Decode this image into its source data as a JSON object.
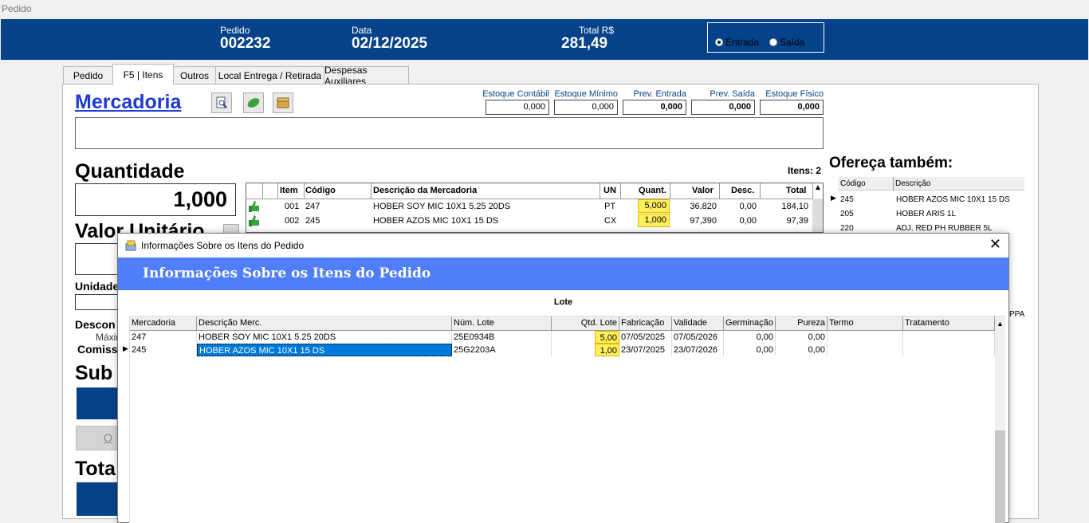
{
  "window": {
    "title": "Pedido"
  },
  "header": {
    "pedido_label": "Pedido",
    "pedido_value": "002232",
    "data_label": "Data",
    "data_value": "02/12/2025",
    "total_label": "Total R$",
    "total_value": "281,49",
    "radio_entrada": "Entrada",
    "radio_saida": "Saída",
    "selected_radio": "Entrada"
  },
  "tabs": [
    {
      "label": "Pedido"
    },
    {
      "label": "F5 | Itens"
    },
    {
      "label": "Outros"
    },
    {
      "label": "Local Entrega  / Retirada"
    },
    {
      "label": "Despesas Auxiliares"
    }
  ],
  "active_tab": "F5 | Itens",
  "form": {
    "mercadoria_title": "Mercadoria",
    "quantidade_label": "Quantidade",
    "quantidade_value": "1,000",
    "valor_unitario_label": "Valor Unitário",
    "unidade_label": "Unidade",
    "desconto_label": "Descon",
    "maximo_label": "Máxim",
    "comissao_label": "Comiss",
    "subtotal_label": "Sub",
    "total_label": "Tota",
    "ok_button_label": "O"
  },
  "stock": [
    {
      "label": "Estoque Contábil",
      "value": "0,000"
    },
    {
      "label": "Estoque Mínimo",
      "value": "0,000"
    },
    {
      "label": "Prev. Entrada",
      "value": "0,000"
    },
    {
      "label": "Prev. Saída",
      "value": "0,000"
    },
    {
      "label": "Estoque Físico",
      "value": "0,000"
    }
  ],
  "items_grid": {
    "count_label": "Itens: 2",
    "columns": [
      "Item",
      "Código",
      "Descrição da Mercadoria",
      "UN",
      "Quant.",
      "Valor",
      "Desc.",
      "Total"
    ],
    "rows": [
      {
        "item": "001",
        "codigo": "247",
        "descricao": "HOBER SOY MIC 10X1 5.25 20DS",
        "un": "PT",
        "quant": "5,000",
        "valor": "36,820",
        "desc": "0,00",
        "total": "184,10"
      },
      {
        "item": "002",
        "codigo": "245",
        "descricao": "HOBER AZOS MIC 10X1 15 DS",
        "un": "CX",
        "quant": "1,000",
        "valor": "97,390",
        "desc": "0,00",
        "total": "97,39"
      }
    ]
  },
  "offer": {
    "title": "Ofereça também:",
    "columns": [
      "Código",
      "Descrição"
    ],
    "rows": [
      {
        "codigo": "245",
        "descricao": "HOBER AZOS MIC 10X1 15 DS"
      },
      {
        "codigo": "205",
        "descricao": "HOBER ARIS 1L"
      },
      {
        "codigo": "220",
        "descricao": "ADJ. RED PH  RUBBER 5L"
      }
    ],
    "partial_text": "PPA"
  },
  "modal": {
    "title": "Informações Sobre os Itens do Pedido",
    "banner": "Informações Sobre os Itens do Pedido",
    "section_label": "Lote",
    "columns": [
      "Mercadoria",
      "Descrição Merc.",
      "Núm. Lote",
      "Qtd. Lote",
      "Fabricação",
      "Validade",
      "Germinação",
      "Pureza",
      "Termo",
      "Tratamento"
    ],
    "rows": [
      {
        "mercadoria": "247",
        "descricao": "HOBER SOY MIC 10X1 5.25 20DS",
        "lote": "25E0934B",
        "qtd": "5,00",
        "fabricacao": "07/05/2025",
        "validade": "07/05/2026",
        "germinacao": "0,00",
        "pureza": "0,00",
        "termo": "",
        "tratamento": ""
      },
      {
        "mercadoria": "245",
        "descricao": "HOBER AZOS MIC 10X1 15 DS",
        "lote": "25G2203A",
        "qtd": "1,00",
        "fabricacao": "23/07/2025",
        "validade": "23/07/2026",
        "germinacao": "0,00",
        "pureza": "0,00",
        "termo": "",
        "tratamento": ""
      }
    ]
  },
  "colors": {
    "header_bg": "#06428a",
    "banner_bg": "#4f7ef8",
    "qty_highlight": "#ffef5e",
    "selection": "#0078d7",
    "link_blue": "#1f3bd1"
  }
}
